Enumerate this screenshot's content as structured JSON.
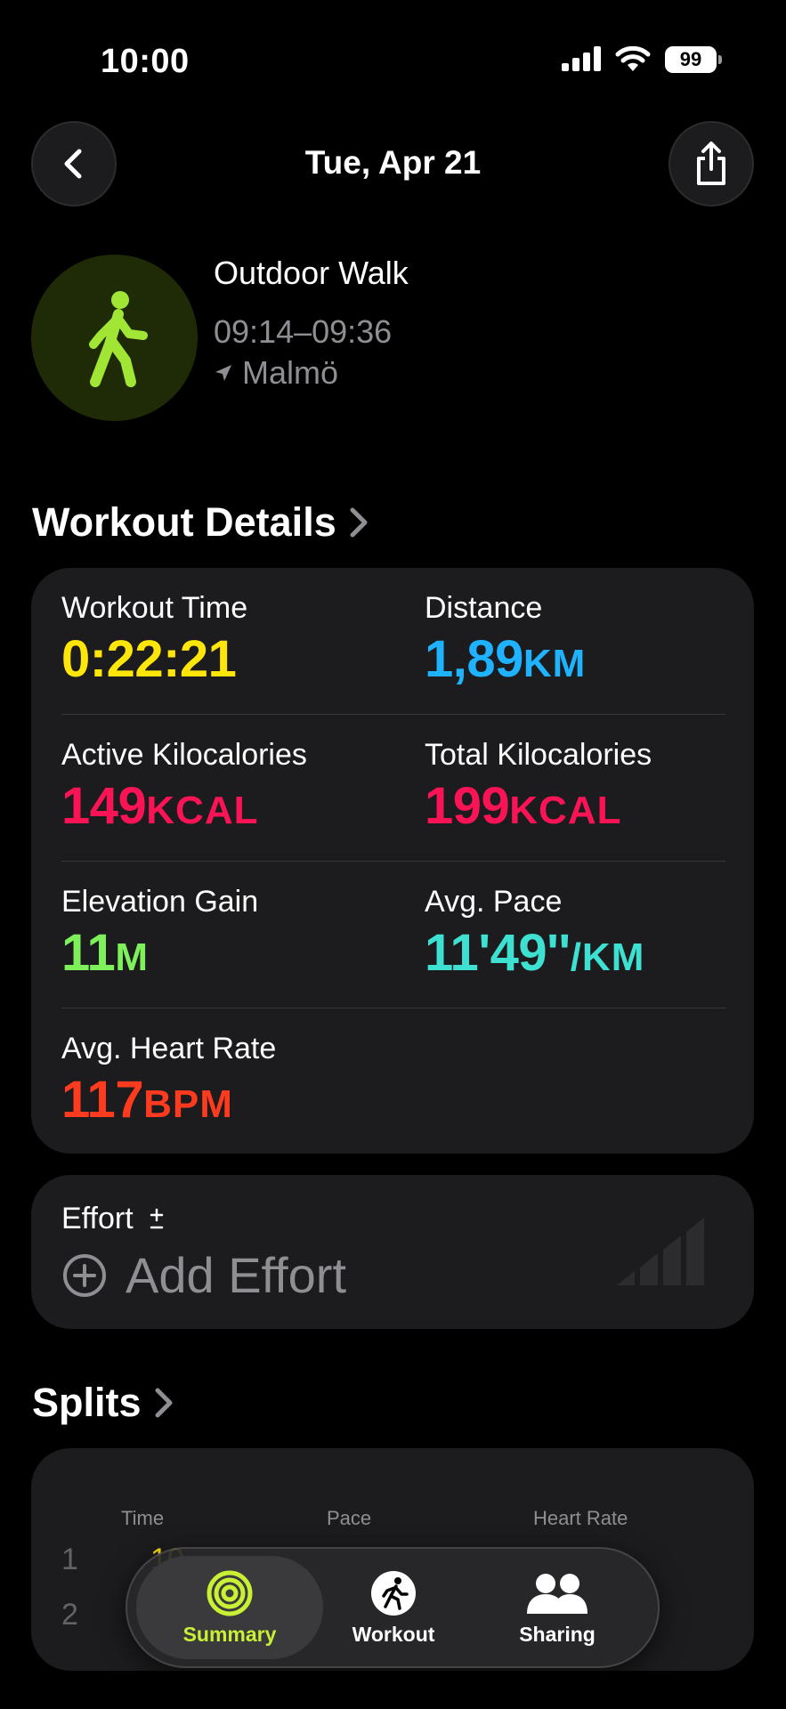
{
  "status": {
    "time": "10:00",
    "battery": "99"
  },
  "nav": {
    "title": "Tue, Apr 21"
  },
  "workout": {
    "title": "Outdoor Walk",
    "time_range": "09:14–09:36",
    "location": "Malmö"
  },
  "details": {
    "section_title": "Workout Details",
    "metrics": [
      {
        "label": "Workout Time",
        "value": "0:22:21",
        "unit": "",
        "color": "#ffe60a"
      },
      {
        "label": "Distance",
        "value": "1,89",
        "unit": "KM",
        "color": "#1fb2ff"
      },
      {
        "label": "Active Kilocalories",
        "value": "149",
        "unit": "KCAL",
        "color": "#fa1456"
      },
      {
        "label": "Total Kilocalories",
        "value": "199",
        "unit": "KCAL",
        "color": "#fa1456"
      },
      {
        "label": "Elevation Gain",
        "value": "11",
        "unit": "M",
        "color": "#7ef05a"
      },
      {
        "label": "Avg. Pace",
        "value": "11'49''",
        "unit": "/KM",
        "color": "#3ee0d2"
      },
      {
        "label": "Avg. Heart Rate",
        "value": "117",
        "unit": "BPM",
        "color": "#ff3b1f"
      }
    ]
  },
  "effort": {
    "label": "Effort",
    "add_label": "Add Effort"
  },
  "splits": {
    "section_title": "Splits",
    "headers": {
      "time": "Time",
      "pace": "Pace",
      "heart_rate": "Heart Rate"
    },
    "rows": [
      {
        "index": "1",
        "time": "10"
      },
      {
        "index": "2",
        "time": "1"
      }
    ]
  },
  "tabs": [
    {
      "label": "Summary",
      "icon": "activity-rings-icon",
      "active": true,
      "color": "#c8f034"
    },
    {
      "label": "Workout",
      "icon": "running-figure-icon",
      "active": false,
      "color": "#ffffff"
    },
    {
      "label": "Sharing",
      "icon": "people-icon",
      "active": false,
      "color": "#ffffff"
    }
  ]
}
